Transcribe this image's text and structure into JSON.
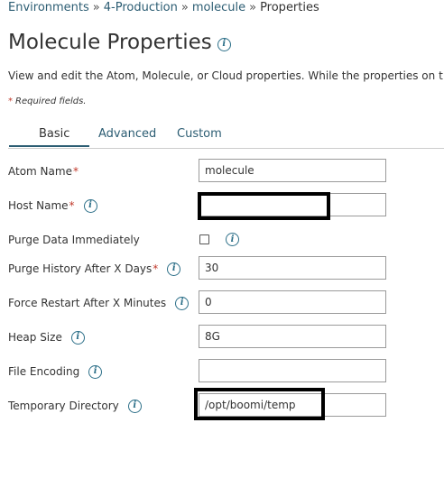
{
  "breadcrumb": {
    "environments": "Environments",
    "production": "4-Production",
    "molecule": "molecule",
    "current": "Properties",
    "separator": "»"
  },
  "page": {
    "title": "Molecule Properties",
    "description": "View and edit the Atom, Molecule, or Cloud properties. While the properties on t",
    "required_note": "Required fields.",
    "required_marker": "*"
  },
  "tabs": [
    {
      "label": "Basic",
      "active": true
    },
    {
      "label": "Advanced",
      "active": false
    },
    {
      "label": "Custom",
      "active": false
    }
  ],
  "form": {
    "atom_name": {
      "label": "Atom Name",
      "value": "molecule"
    },
    "host_name": {
      "label": "Host Name",
      "value": ""
    },
    "purge_data": {
      "label": "Purge Data Immediately",
      "checked": false
    },
    "purge_history": {
      "label": "Purge History After X Days",
      "value": "30"
    },
    "force_restart": {
      "label": "Force Restart After X Minutes",
      "value": "0"
    },
    "heap_size": {
      "label": "Heap Size",
      "value": "8G"
    },
    "file_encoding": {
      "label": "File Encoding",
      "value": ""
    },
    "temp_dir": {
      "label": "Temporary Directory",
      "value": "/opt/boomi/temp"
    }
  },
  "icons": {
    "info": "i"
  },
  "colors": {
    "link": "#2c5d73",
    "required": "#c0392b",
    "text": "#333333",
    "redaction": "#000000"
  }
}
